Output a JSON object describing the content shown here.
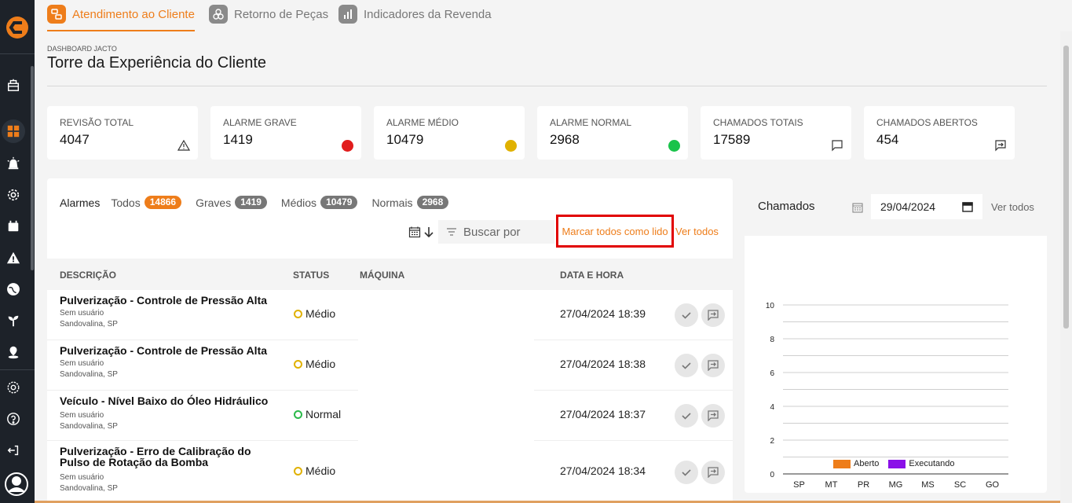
{
  "nav_tabs": [
    {
      "label": "Atendimento ao Cliente",
      "icon": "customer-service-icon",
      "active": true
    },
    {
      "label": "Retorno de Peças",
      "icon": "parts-icon",
      "active": false
    },
    {
      "label": "Indicadores da Revenda",
      "icon": "bar-chart-icon",
      "active": false
    }
  ],
  "sidebar": {
    "icons": [
      "tower-icon",
      "dashboard-icon",
      "alarm-icon",
      "gear-service-icon",
      "calendar-icon",
      "warning-icon",
      "globe-icon",
      "plant-icon",
      "location-icon",
      "settings-icon",
      "help-icon",
      "logout-icon",
      "avatar-icon"
    ],
    "active": "dashboard-icon"
  },
  "page": {
    "crumb": "DASHBOARD JACTO",
    "title": "Torre da Experiência do Cliente"
  },
  "cards": [
    {
      "label": "REVISÃO TOTAL",
      "value": "4047",
      "icon": "warning-icon"
    },
    {
      "label": "ALARME GRAVE",
      "value": "1419",
      "color": "#e11d1d"
    },
    {
      "label": "ALARME MÉDIO",
      "value": "10479",
      "color": "#e0b100"
    },
    {
      "label": "ALARME NORMAL",
      "value": "2968",
      "color": "#19c34a"
    },
    {
      "label": "CHAMADOS TOTAIS",
      "value": "17589",
      "icon": "chat-icon"
    },
    {
      "label": "CHAMADOS ABERTOS",
      "value": "454",
      "icon": "open-ticket-icon"
    }
  ],
  "alarms": {
    "title": "Alarmes",
    "filters": [
      {
        "label": "Todos",
        "count": "14866"
      },
      {
        "label": "Graves",
        "count": "1419"
      },
      {
        "label": "Médios",
        "count": "10479"
      },
      {
        "label": "Normais",
        "count": "2968"
      }
    ],
    "search_placeholder": "Buscar por",
    "mark_all_read": "Marcar todos como lido",
    "see_all": "Ver todos",
    "columns": [
      "DESCRIÇÃO",
      "STATUS",
      "MÁQUINA",
      "DATA E HORA"
    ],
    "rows": [
      {
        "title": "Pulverização - Controle de Pressão Alta",
        "user": "Sem usuário",
        "location": "Sandovalina, SP",
        "status": "Médio",
        "datetime": "27/04/2024 18:39"
      },
      {
        "title": "Pulverização - Controle de Pressão Alta",
        "user": "Sem usuário",
        "location": "Sandovalina, SP",
        "status": "Médio",
        "datetime": "27/04/2024 18:38"
      },
      {
        "title": "Veículo - Nível Baixo do Óleo Hidráulico",
        "user": "Sem usuário",
        "location": "Sandovalina, SP",
        "status": "Normal",
        "datetime": "27/04/2024 18:37"
      },
      {
        "title": "Pulverização - Erro de Calibração do Pulso de Rotação da Bomba",
        "user": "Sem usuário",
        "location": "Sandovalina, SP",
        "status": "Médio",
        "datetime": "27/04/2024 18:34"
      }
    ]
  },
  "chamados": {
    "title": "Chamados",
    "date": "29/04/2024",
    "see_all": "Ver todos"
  },
  "chart_data": {
    "type": "bar",
    "categories": [
      "SP",
      "MT",
      "PR",
      "MG",
      "MS",
      "SC",
      "GO"
    ],
    "series": [
      {
        "name": "Aberto",
        "values": [
          0,
          0,
          0,
          0,
          0,
          0,
          0
        ],
        "color": "#ee7d1a"
      },
      {
        "name": "Executando",
        "values": [
          0,
          0,
          0,
          0,
          0,
          0,
          0
        ],
        "color": "#8a10e8"
      }
    ],
    "yticks": [
      "0",
      "2",
      "4",
      "6",
      "8",
      "10"
    ],
    "ylim": [
      0,
      10
    ],
    "grid": true,
    "legend": "bottom"
  }
}
